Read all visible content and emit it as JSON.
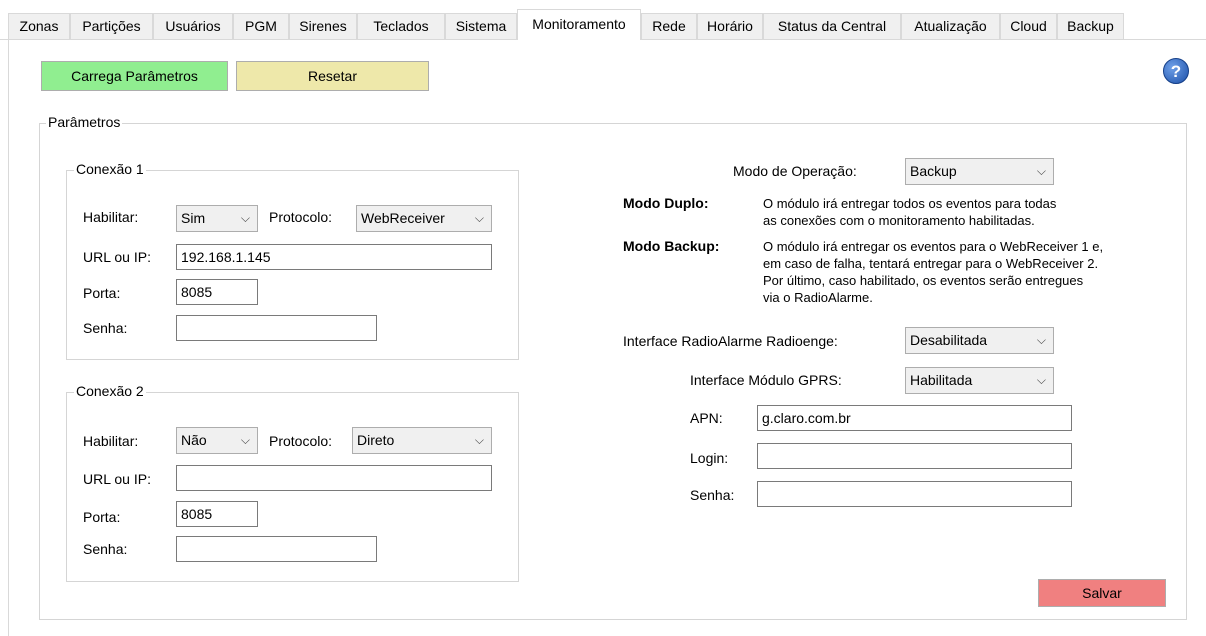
{
  "tabs": [
    "Zonas",
    "Partições",
    "Usuários",
    "PGM",
    "Sirenes",
    "Teclados",
    "Sistema",
    "Monitoramento",
    "Rede",
    "Horário",
    "Status da Central",
    "Atualização",
    "Cloud",
    "Backup"
  ],
  "active_tab": "Monitoramento",
  "toolbar": {
    "load_label": "Carrega Parâmetros",
    "reset_label": "Resetar",
    "help_label": "?"
  },
  "params_group": "Parâmetros",
  "conn1": {
    "title": "Conexão 1",
    "enable_label": "Habilitar:",
    "enable_value": "Sim",
    "protocol_label": "Protocolo:",
    "protocol_value": "WebReceiver",
    "url_label": "URL ou IP:",
    "url_value": "192.168.1.145",
    "port_label": "Porta:",
    "port_value": "8085",
    "password_label": "Senha:",
    "password_value": ""
  },
  "conn2": {
    "title": "Conexão 2",
    "enable_label": "Habilitar:",
    "enable_value": "Não",
    "protocol_label": "Protocolo:",
    "protocol_value": "Direto",
    "url_label": "URL ou IP:",
    "url_value": "",
    "port_label": "Porta:",
    "port_value": "8085",
    "password_label": "Senha:",
    "password_value": ""
  },
  "mode": {
    "label": "Modo de Operação:",
    "value": "Backup",
    "dual_title": "Modo Duplo:",
    "dual_line1": "O módulo irá entregar todos os eventos para todas",
    "dual_line2": "as conexões com o monitoramento habilitadas.",
    "backup_title": "Modo Backup:",
    "backup_line1": "O módulo irá entregar os eventos para o WebReceiver 1 e,",
    "backup_line2": "em caso de falha, tentará entregar para o WebReceiver 2.",
    "backup_line3": "Por último, caso habilitado, os eventos serão entregues",
    "backup_line4": "via o RadioAlarme."
  },
  "radio": {
    "label": "Interface RadioAlarme Radioenge:",
    "value": "Desabilitada"
  },
  "gprs": {
    "label": "Interface Módulo GPRS:",
    "value": "Habilitada",
    "apn_label": "APN:",
    "apn_value": "g.claro.com.br",
    "login_label": "Login:",
    "login_value": "",
    "password_label": "Senha:",
    "password_value": ""
  },
  "save_label": "Salvar",
  "colors": {
    "load": "#90ee90",
    "reset": "#eee8aa",
    "save": "#f08080",
    "help": "#1b4fa8"
  },
  "icons": {
    "help": "help-icon",
    "dropdown": "chevron-down-icon"
  }
}
